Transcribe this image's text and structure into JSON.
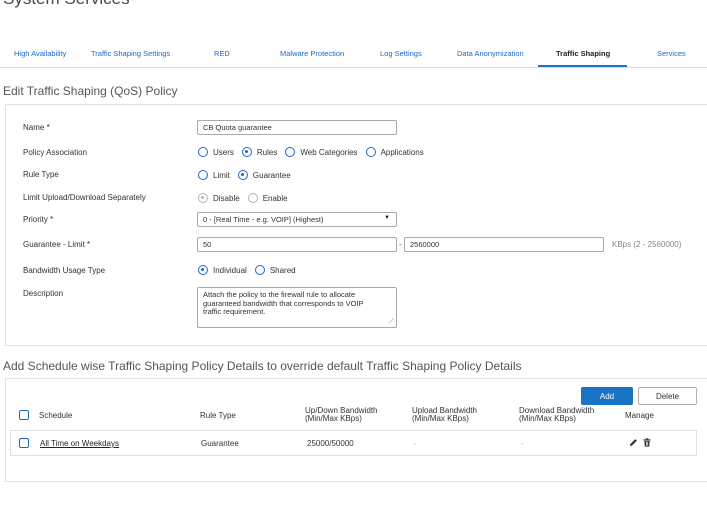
{
  "page": {
    "title": "System Services"
  },
  "tabs": [
    {
      "label": "High Availability"
    },
    {
      "label": "Traffic Shaping Settings"
    },
    {
      "label": "RED"
    },
    {
      "label": "Malware Protection"
    },
    {
      "label": "Log Settings"
    },
    {
      "label": "Data Anonymization"
    },
    {
      "label": "Traffic Shaping"
    },
    {
      "label": "Services"
    }
  ],
  "active_tab": "Traffic Shaping",
  "policy": {
    "section_title": "Edit Traffic Shaping (QoS) Policy",
    "name_label": "Name *",
    "name_value": "CB Quota guarantee",
    "association_label": "Policy Association",
    "association_options": [
      "Users",
      "Rules",
      "Web Categories",
      "Applications"
    ],
    "association_selected": "Rules",
    "rule_type_label": "Rule Type",
    "rule_type_options": [
      "Limit",
      "Guarantee"
    ],
    "rule_type_selected": "Guarantee",
    "limit_separately_label": "Limit Upload/Download Separately",
    "limit_separately_options": [
      "Disable",
      "Enable"
    ],
    "limit_separately_selected": "Disable",
    "priority_label": "Priority *",
    "priority_value": "0 - [Real Time - e.g. VOIP] (Highest)",
    "guarantee_label": "Guarantee - Limit *",
    "guarantee_value": "50",
    "guarantee_separator": "-",
    "limit_value": "2560000",
    "unit_hint": "KBps  (2 - 2560000)",
    "usage_type_label": "Bandwidth Usage Type",
    "usage_type_options": [
      "Individual",
      "Shared"
    ],
    "usage_type_selected": "Individual",
    "description_label": "Description",
    "description_lines": [
      "Attach the policy to the firewall rule to allocate",
      "guaranteed bandwidth that corresponds to VOIP",
      "traffic requirement."
    ]
  },
  "schedule": {
    "section_title": "Add Schedule wise Traffic Shaping Policy Details to override default Traffic Shaping Policy Details",
    "add_label": "Add",
    "delete_label": "Delete",
    "columns": {
      "schedule": "Schedule",
      "rule_type": "Rule Type",
      "updown_line1": "Up/Down Bandwidth",
      "updown_line2": "(Min/Max KBps)",
      "upload_line1": "Upload Bandwidth",
      "upload_line2": "(Min/Max KBps)",
      "download_line1": "Download Bandwidth",
      "download_line2": "(Min/Max KBps)",
      "manage": "Manage"
    },
    "rows": [
      {
        "schedule": "All Time on Weekdays",
        "rule_type": "Guarantee",
        "updown": "25000/50000",
        "upload": "-",
        "download": "-"
      }
    ]
  },
  "icons": {
    "edit": "pencil-icon",
    "delete": "trash-icon"
  },
  "colors": {
    "accent": "#1a73c7",
    "link": "#1a6ac8"
  }
}
